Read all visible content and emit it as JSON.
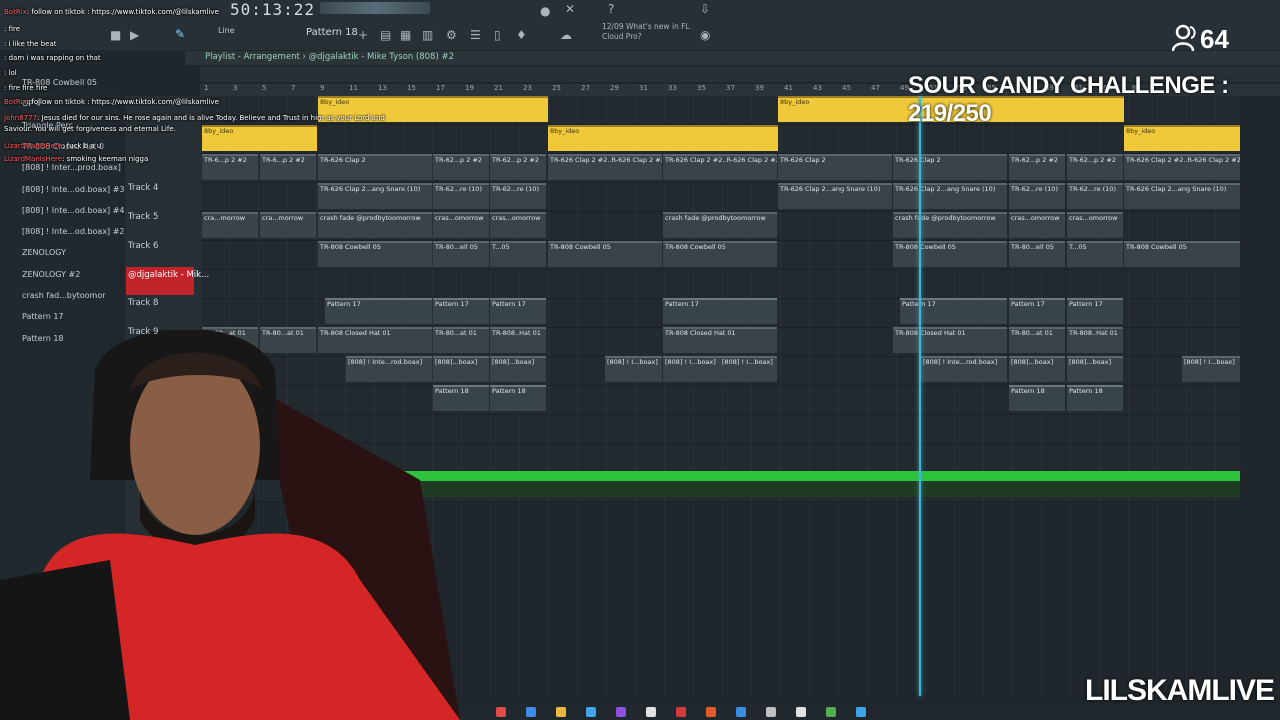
{
  "toolbar": {
    "clock": "50:13:22",
    "pattern": "Pattern 18",
    "line_mode": "Line",
    "news": "12/09  What's new in FL Cloud Pro?"
  },
  "playlist": {
    "title": "Playlist - Arrangement",
    "breadcrumb": "@djgalaktik - Mike Tyson (808) #2",
    "bar_numbers": [
      "1",
      "3",
      "5",
      "7",
      "9",
      "11",
      "13",
      "15",
      "17",
      "19",
      "21",
      "23",
      "25",
      "27",
      "29",
      "31",
      "33",
      "35",
      "37",
      "39",
      "41",
      "43",
      "45",
      "47",
      "49",
      "51",
      "53",
      "55",
      "57",
      "59",
      "61",
      "63",
      "65"
    ]
  },
  "browser": {
    "items": [
      "TR-808 Cowbell 05",
      "OP 4",
      "Triangle Perc",
      "TR-808 Closed Hat 0",
      "[808] ! Inter...prod.boax]",
      "[808] ! Inte...od.boax] #3",
      "[808] ! Inte...od.boax] #4",
      "[808] ! Inte...od.boax] #2",
      "ZENOLOGY",
      "ZENOLOGY #2",
      "crash fad...bytoomor",
      "Pattern 17",
      "Pattern 18"
    ]
  },
  "tracks": {
    "labels": [
      "Track 4",
      "Track 5",
      "Track 6",
      "@djgalaktik - Mik...",
      "Track 8",
      "Track 9"
    ]
  },
  "clips": {
    "row1_yellow": "8by_ideo",
    "row2_label": "TR-6...p 2 #2",
    "clap2": "TR-626 Clap 2",
    "clap2_short": "TR-62...p 2 #2",
    "clap2_r": "TR-626 Clap 2 #2..R-626 Clap 2 #2",
    "snare": "TR-626 Clap 2...ang Snare (10)",
    "snare_short": "TR-62...re (10)",
    "crash_short": "cra...morrow",
    "crash": "crash fade @prodbytoomorrow",
    "crash_mid": "cras...omorrow",
    "cowbell": "TR-808 Cowbell 05",
    "cowbell_short": "TR-80...ell 05",
    "cowbell_tiny": "T...05",
    "pattern17": "Pattern 17",
    "hat_short": "TR-80...at 01",
    "hat": "TR-808 Closed Hat 01",
    "hat_b": "TR-808..Hat 01",
    "inter": "[808] ! Inte...rod.boax]",
    "inter_short": "[808]...boax]",
    "inter_tiny": "[808] ! I...boax]",
    "pattern18": "Pattern 18"
  },
  "overlay": {
    "viewers": "64",
    "challenge": "SOUR CANDY CHALLENGE : 219/250",
    "watermark": "LILSKAMLIVE"
  },
  "chat": [
    {
      "user": "BotRix",
      "msg": ": follow on tiktok : https://www.tiktok.com/@lilskamlive"
    },
    {
      "user": "",
      "msg": ": fire"
    },
    {
      "user": "",
      "msg": ": i like the beat"
    },
    {
      "user": "",
      "msg": ": dam i was rapping on that"
    },
    {
      "user": "",
      "msg": ": lol"
    },
    {
      "user": "",
      "msg": ": fire fire fire"
    },
    {
      "user": "BotRix",
      "msg": ": follow on tiktok : https://www.tiktok.com/@lilskamlive"
    },
    {
      "user": "John8777",
      "msg": ": Jesus died for our sins. He rose again and is alive Today. Believe and Trust in him as your Lord and"
    },
    {
      "user": "",
      "msg": "Saviour. You will get forgiveness and eternal Life."
    },
    {
      "user": "LizardManIsHere",
      "msg": ": fuck b a u"
    },
    {
      "user": "LizardManIsHere",
      "msg": ": smoking keeman nigga"
    }
  ],
  "colors": {
    "accent_green": "#2ec33a",
    "playhead": "#3fb6d6",
    "clip_yellow": "#f0c93a",
    "record_red": "#c1232b"
  }
}
